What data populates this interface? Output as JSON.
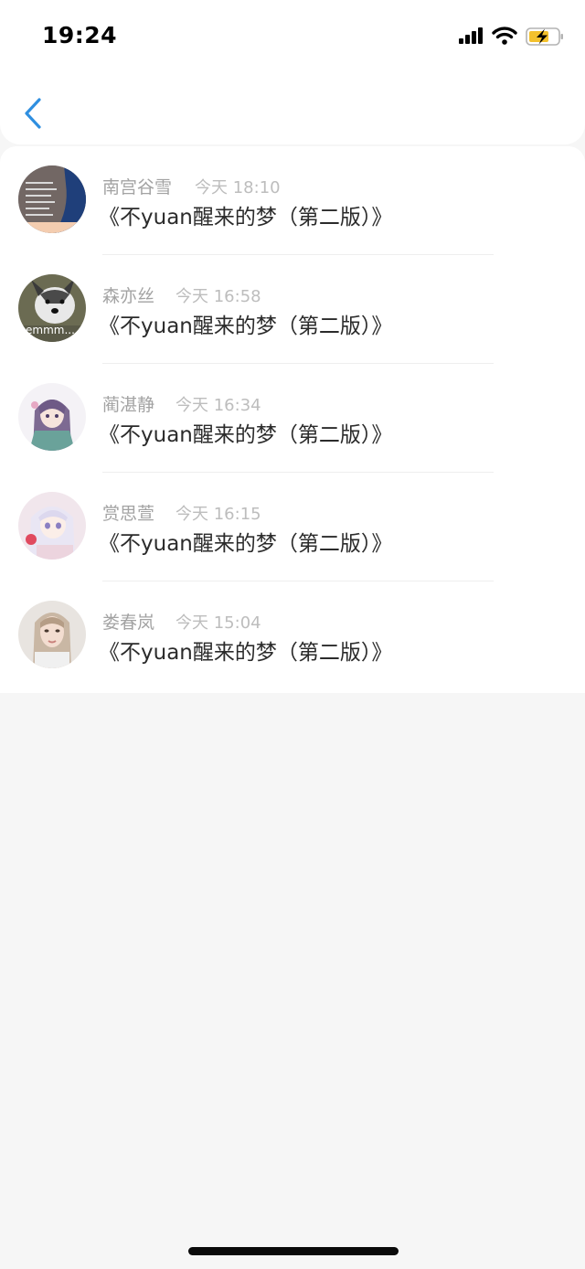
{
  "status_bar": {
    "time": "19:24",
    "signal_icon": "cellular-signal-icon",
    "wifi_icon": "wifi-icon",
    "battery_icon": "battery-charging-icon"
  },
  "nav": {
    "back_icon": "chevron-left-icon"
  },
  "messages": [
    {
      "name": "南宫谷雪",
      "time": "今天 18:10",
      "content": "《不yuan醒来的梦（第二版）》",
      "avatar": "avatar-text-screenshot"
    },
    {
      "name": "森亦丝",
      "time": "今天 16:58",
      "content": "《不yuan醒来的梦（第二版）》",
      "avatar": "avatar-husky-dog",
      "avatar_caption": "emmm..."
    },
    {
      "name": "蔺湛静",
      "time": "今天 16:34",
      "content": "《不yuan醒来的梦（第二版）》",
      "avatar": "avatar-anime-girl-purple"
    },
    {
      "name": "赏思萱",
      "time": "今天 16:15",
      "content": "《不yuan醒来的梦（第二版）》",
      "avatar": "avatar-anime-girl-white"
    },
    {
      "name": "娄春岚",
      "time": "今天 15:04",
      "content": "《不yuan醒来的梦（第二版）》",
      "avatar": "avatar-woman-photo"
    }
  ],
  "colors": {
    "accent": "#2f8fe0",
    "name_text": "#a3a3a3",
    "time_text": "#bdbdbd",
    "content_text": "#2b2b2b",
    "background": "#f6f6f6"
  }
}
